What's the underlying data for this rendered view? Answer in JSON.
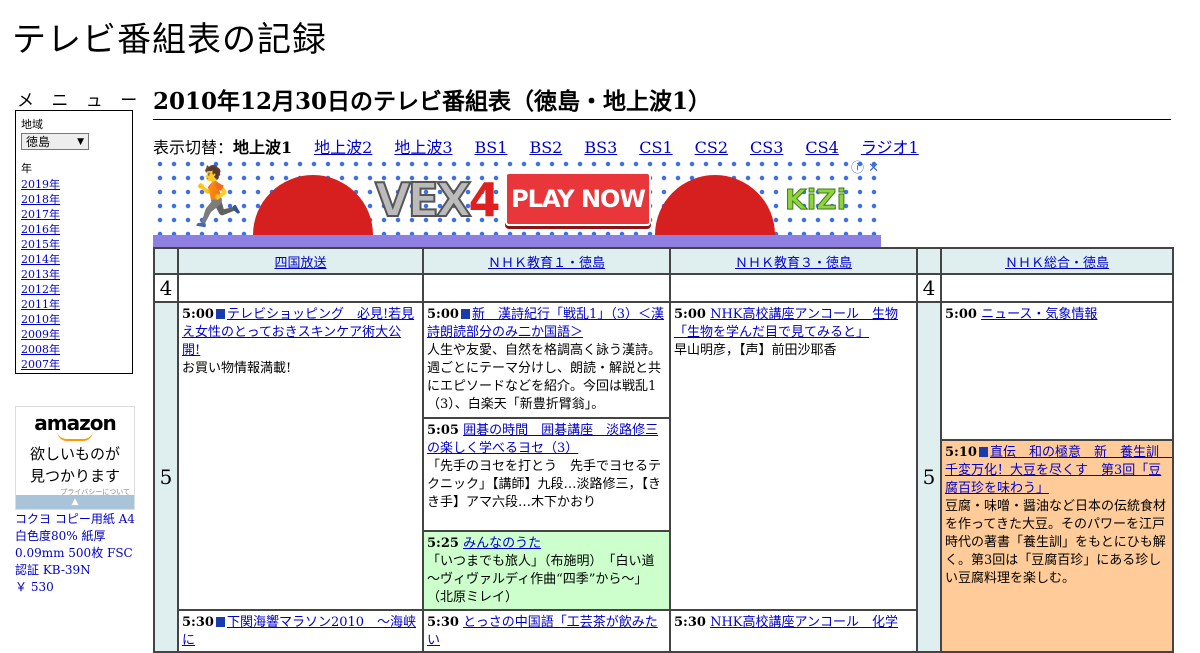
{
  "site": {
    "title": "テレビ番組表の記録"
  },
  "sidebar": {
    "menu_heading": "メ ニ ュ ー",
    "region_label": "地域",
    "region_value": "徳島",
    "year_label": "年",
    "years": [
      "2019年",
      "2018年",
      "2017年",
      "2016年",
      "2015年",
      "2014年",
      "2013年",
      "2012年",
      "2011年",
      "2010年",
      "2009年",
      "2008年",
      "2007年"
    ],
    "ad": {
      "brand": "amazon",
      "tagline1": "欲しいものが",
      "tagline2": "見つかります",
      "privacy": "プライバシーについて"
    },
    "product": {
      "name": "コクヨ コピー用紙 A4 白色度80% 紙厚 0.09mm 500枚 FSC認証 KB-39N",
      "price": "￥ 530"
    }
  },
  "main": {
    "title": "2010年12月30日のテレビ番組表（徳島・地上波1）",
    "switch_label": "表示切替：",
    "switch_current": "地上波1",
    "switch_links": [
      "地上波2",
      "地上波3",
      "BS1",
      "BS2",
      "BS3",
      "CS1",
      "CS2",
      "CS3",
      "CS4",
      "ラジオ1"
    ]
  },
  "banner": {
    "game": "VEX",
    "game_num": "4",
    "cta": "PLAY NOW",
    "brand": "KiZi",
    "adinfo": "ⓘ ✕"
  },
  "schedule": {
    "channels": [
      "四国放送",
      "ＮＨＫ教育１・徳島",
      "ＮＨＫ教育３・徳島",
      "ＮＨＫ総合・徳島"
    ],
    "hour_a": "4",
    "hour_b": "5",
    "col1": [
      {
        "time": "5:00",
        "title": "テレビショッピング　必見!若見え女性のとっておきスキンケア術大公開!",
        "desc": "お買い物情報満載!"
      },
      {
        "time": "5:30",
        "title": "下関海響マラソン2010　～海峡に"
      }
    ],
    "col2": [
      {
        "time": "5:00",
        "title": "新　漢詩紀行「戦乱1」（3）＜漢詩朗読部分のみ二か国語＞",
        "desc": "人生や友愛、自然を格調高く詠う漢詩。週ごとにテーマ分けし、朗読・解説と共にエピソードなどを紹介。今回は戦乱1（3）、白楽天「新豊折臂翁」。"
      },
      {
        "time": "5:05",
        "title": "囲碁の時間　囲碁講座　淡路修三の楽しく学べるヨセ（3）",
        "desc": "「先手のヨセを打とう　先手でヨセるテクニック」【講師】九段…淡路修三，【きき手】アマ六段…木下かおり"
      },
      {
        "time": "5:25",
        "title": "みんなのうた",
        "desc": "「いつまでも旅人」（布施明）　「白い道～ヴィヴァルディ作曲“四季”から～」（北原ミレイ）"
      },
      {
        "time": "5:30",
        "title": "とっさの中国語「工芸茶が飲みたい"
      }
    ],
    "col3": [
      {
        "time": "5:00",
        "title": "NHK高校講座アンコール　生物「生物を学んだ目で見てみると」",
        "desc": "早山明彦，【声】前田沙耶香"
      },
      {
        "time": "5:30",
        "title": "NHK高校講座アンコール　化学"
      }
    ],
    "col4": [
      {
        "time": "5:00",
        "title": "ニュース・気象情報"
      },
      {
        "time": "5:10",
        "title": "直伝　和の極意　新　養生訓　千変万化！大豆を尽くす　第3回「豆腐百珍を味わう」",
        "desc": "豆腐・味噌・醤油など日本の伝統食材を作ってきた大豆。そのパワーを江戸時代の著書「養生訓」をもとにひも解く。第3回は「豆腐百珍」にある珍しい豆腐料理を楽しむ。"
      }
    ]
  },
  "colors": {
    "link": "#0000cc",
    "header_bg": "#dfefef",
    "green_prog": "#ccffcc",
    "orange_prog": "#ffcc99"
  }
}
